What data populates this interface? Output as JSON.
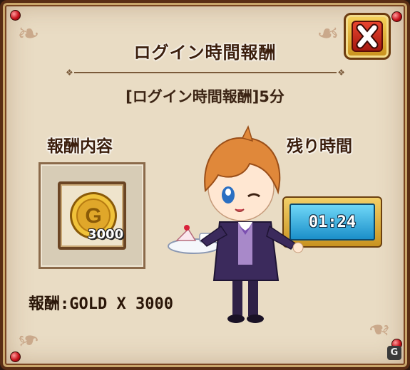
{
  "dialog": {
    "title": "ログイン時間報酬",
    "subtitle": "[ログイン時間報酬]5分",
    "close_icon": "close-x-icon"
  },
  "reward": {
    "label": "報酬内容",
    "item_icon": "gold-coin-icon",
    "coin_letter": "G",
    "count": "3000",
    "description": "報酬:GOLD X 3000"
  },
  "timer": {
    "label": "残り時間",
    "value": "01:24"
  },
  "colors": {
    "panel": "#e9dcc4",
    "frame": "#5a2d14",
    "close_red": "#c8201a",
    "gold": "#e0a72a",
    "timer_blue": "#2aa3dc"
  }
}
